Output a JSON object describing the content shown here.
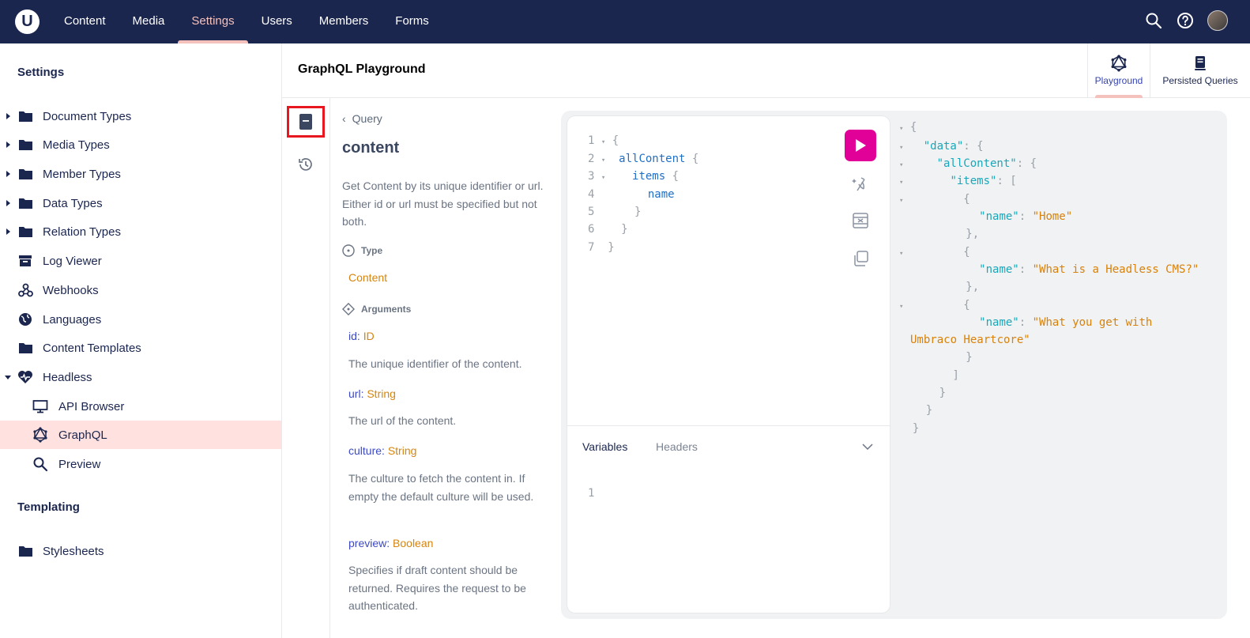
{
  "topnav": {
    "logo": "U",
    "items": [
      {
        "label": "Content",
        "active": false
      },
      {
        "label": "Media",
        "active": false
      },
      {
        "label": "Settings",
        "active": true
      },
      {
        "label": "Users",
        "active": false
      },
      {
        "label": "Members",
        "active": false
      },
      {
        "label": "Forms",
        "active": false
      }
    ],
    "icons": [
      "search-icon",
      "help-icon",
      "avatar"
    ]
  },
  "sidebar": {
    "heading": "Settings",
    "items": [
      {
        "label": "Document Types",
        "icon": "folder-icon",
        "caret": "closed"
      },
      {
        "label": "Media Types",
        "icon": "folder-icon",
        "caret": "closed"
      },
      {
        "label": "Member Types",
        "icon": "folder-icon",
        "caret": "closed"
      },
      {
        "label": "Data Types",
        "icon": "folder-icon",
        "caret": "closed"
      },
      {
        "label": "Relation Types",
        "icon": "folder-icon",
        "caret": "closed"
      },
      {
        "label": "Log Viewer",
        "icon": "archive-icon"
      },
      {
        "label": "Webhooks",
        "icon": "webhook-icon"
      },
      {
        "label": "Languages",
        "icon": "globe-icon"
      },
      {
        "label": "Content Templates",
        "icon": "folder-icon"
      },
      {
        "label": "Headless",
        "icon": "heart-icon",
        "caret": "open"
      },
      {
        "label": "API Browser",
        "icon": "monitor-icon",
        "child": true
      },
      {
        "label": "GraphQL",
        "icon": "graphql-icon",
        "child": true,
        "selected": true
      },
      {
        "label": "Preview",
        "icon": "search-icon",
        "child": true
      }
    ],
    "templating_heading": "Templating",
    "templating_items": [
      {
        "label": "Stylesheets",
        "icon": "folder-icon"
      }
    ]
  },
  "header": {
    "title": "GraphQL Playground",
    "tabs": [
      {
        "label": "Playground",
        "icon": "graphql-icon",
        "active": true
      },
      {
        "label": "Persisted Queries",
        "icon": "document-stack-icon",
        "active": false
      }
    ]
  },
  "docs": {
    "back_label": "Query",
    "title": "content",
    "description": "Get Content by its unique identifier or url. Either id or url must be specified but not both.",
    "type_heading": "Type",
    "type_value": "Content",
    "arguments_heading": "Arguments",
    "arguments": [
      {
        "name": "id",
        "type": "ID",
        "description": "The unique identifier of the content."
      },
      {
        "name": "url",
        "type": "String",
        "description": "The url of the content."
      },
      {
        "name": "culture",
        "type": "String",
        "description": "The culture to fetch the content in. If empty the default culture will be used."
      },
      {
        "name": "preview",
        "type": "Boolean",
        "description": "Specifies if draft content should be returned. Requires the request to be authenticated."
      }
    ]
  },
  "editor": {
    "lines": [
      {
        "n": "1",
        "fold": true,
        "text": "{",
        "kind": "punct"
      },
      {
        "n": "2",
        "fold": true,
        "field": "allContent",
        "tail": " {"
      },
      {
        "n": "3",
        "fold": true,
        "field": "items",
        "tail": " {"
      },
      {
        "n": "4",
        "fold": false,
        "field": "name",
        "tail": ""
      },
      {
        "n": "5",
        "fold": false,
        "text": "}",
        "kind": "punct"
      },
      {
        "n": "6",
        "fold": false,
        "text": "}",
        "kind": "punct"
      },
      {
        "n": "7",
        "fold": false,
        "text": "}",
        "kind": "punct"
      }
    ],
    "bottom_tabs": [
      "Variables",
      "Headers"
    ],
    "variables_line": "1"
  },
  "result": {
    "lines": [
      "{",
      "\"data\": {",
      "\"allContent\": {",
      "\"items\": [",
      "{",
      "\"name\": \"Home\"",
      "},",
      "{",
      "\"name\": \"What is a Headless CMS?\"",
      "},",
      "{",
      "\"name\": \"What you get with",
      "Umbraco Heartcore\"",
      "}",
      "]",
      "}",
      "}",
      "}"
    ],
    "keys": [
      "data",
      "allContent",
      "items",
      "name"
    ],
    "values": [
      "Home",
      "What is a Headless CMS?",
      "What you get with Umbraco Heartcore"
    ]
  },
  "colors": {
    "topbar": "#1b264f",
    "accent_pink": "#f5c1bc",
    "run_button": "#e10098",
    "highlight_red": "#e8161f",
    "type_orange": "#d5850f"
  }
}
